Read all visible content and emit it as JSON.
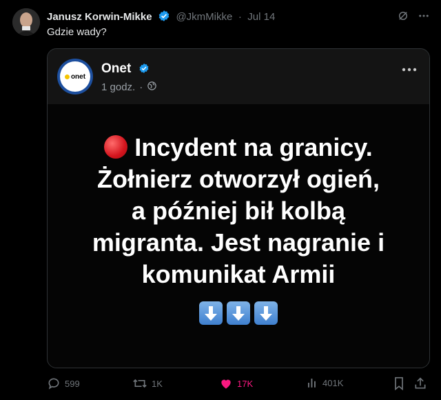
{
  "tweet": {
    "author_name": "Janusz Korwin-Mikke",
    "handle": "@JkmMikke",
    "separator": "·",
    "date": "Jul 14",
    "text": "Gdzie wady?"
  },
  "embedded_post": {
    "source_name": "Onet",
    "logo_text": "onet",
    "time": "1 godz.",
    "separator": "·",
    "headline_lines": [
      "Incydent na granicy.",
      "Żołnierz otworzył ogień,",
      "a później bił kolbą",
      "migranta. Jest nagranie i",
      "komunikat Armii"
    ],
    "arrow_icons": [
      "down-arrow-icon",
      "down-arrow-icon",
      "down-arrow-icon"
    ]
  },
  "actions": {
    "replies": "599",
    "retweets": "1K",
    "likes": "17K",
    "views": "401K"
  },
  "colors": {
    "background": "#000000",
    "verified": "#1d9bf0",
    "like": "#f91880",
    "muted": "#71767b"
  }
}
